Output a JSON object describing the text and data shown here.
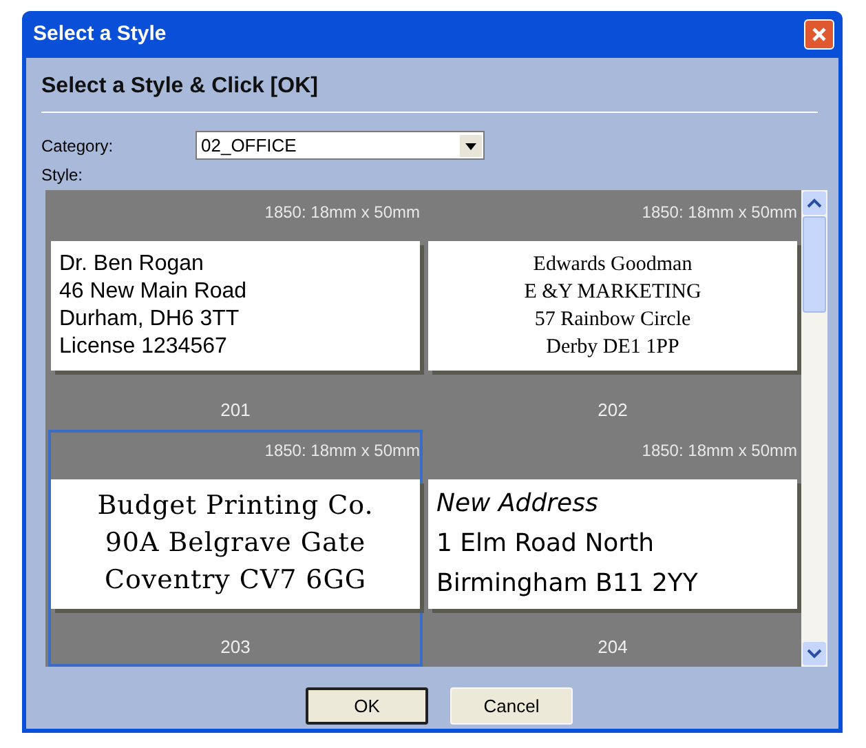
{
  "window": {
    "title": "Select a Style"
  },
  "heading": "Select a Style & Click [OK]",
  "category": {
    "label": "Category:",
    "value": "02_OFFICE"
  },
  "style_label": "Style:",
  "styles": [
    {
      "size": "1850: 18mm x 50mm",
      "number": "201",
      "kind": "sans",
      "selected": false,
      "lines": [
        "Dr. Ben Rogan",
        "46 New Main Road",
        "Durham, DH6 3TT",
        "License 1234567"
      ]
    },
    {
      "size": "1850: 18mm x 50mm",
      "number": "202",
      "kind": "serif",
      "selected": false,
      "lines": [
        "Edwards Goodman",
        "E &Y MARKETING",
        "57 Rainbow Circle",
        "Derby DE1 1PP"
      ]
    },
    {
      "size": "1850: 18mm x 50mm",
      "number": "203",
      "kind": "fancy",
      "selected": true,
      "lines": [
        "Budget Printing Co.",
        "90A Belgrave Gate",
        "Coventry  CV7 6GG"
      ]
    },
    {
      "size": "1850: 18mm x 50mm",
      "number": "204",
      "kind": "round",
      "selected": false,
      "lines": [
        "*New Address*",
        "1 Elm Road North",
        "Birmingham B11 2YY"
      ]
    }
  ],
  "buttons": [
    "OK",
    "Cancel"
  ]
}
